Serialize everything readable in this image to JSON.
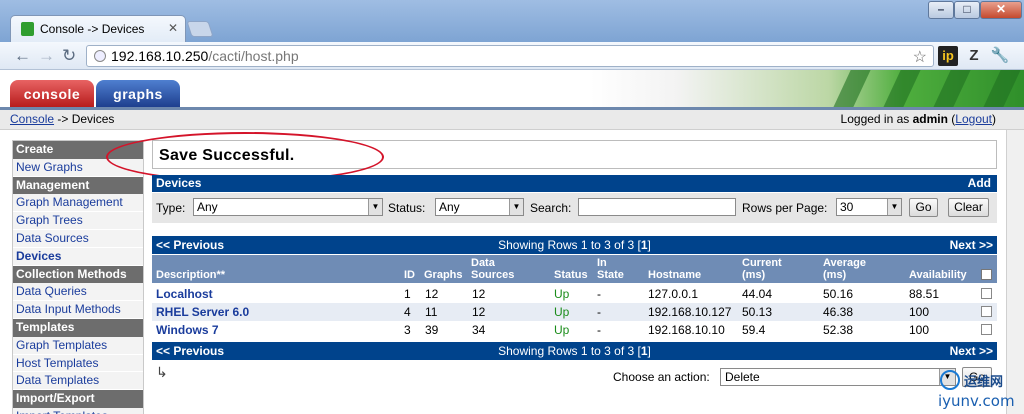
{
  "browser": {
    "tab_title": "Console -> Devices",
    "tab_close": "✕",
    "url_host": "192.168.10.250",
    "url_path": "/cacti/host.php",
    "ext_ip": "ip",
    "ext_z": "Z",
    "win_min": "–",
    "win_max": "□",
    "win_close": "✕"
  },
  "header": {
    "tab_console": "console",
    "tab_graphs": "graphs"
  },
  "breadcrumb": {
    "link": "Console",
    "rest": " -> Devices"
  },
  "login": {
    "prefix": "Logged in as ",
    "user": "admin",
    "open": " (",
    "logout": "Logout",
    "close": ")"
  },
  "sidebar": {
    "rows": [
      {
        "type": "head",
        "label": "Create"
      },
      {
        "type": "item",
        "label": "New Graphs"
      },
      {
        "type": "head",
        "label": "Management"
      },
      {
        "type": "item",
        "label": "Graph Management"
      },
      {
        "type": "item",
        "label": "Graph Trees"
      },
      {
        "type": "item",
        "label": "Data Sources"
      },
      {
        "type": "item",
        "label": "Devices",
        "active": true
      },
      {
        "type": "head",
        "label": "Collection Methods"
      },
      {
        "type": "item",
        "label": "Data Queries"
      },
      {
        "type": "item",
        "label": "Data Input Methods"
      },
      {
        "type": "head",
        "label": "Templates"
      },
      {
        "type": "item",
        "label": "Graph Templates"
      },
      {
        "type": "item",
        "label": "Host Templates"
      },
      {
        "type": "item",
        "label": "Data Templates"
      },
      {
        "type": "head",
        "label": "Import/Export"
      },
      {
        "type": "item",
        "label": "Import Templates"
      }
    ]
  },
  "message": "Save Successful.",
  "devices_panel": {
    "title": "Devices",
    "add": "Add",
    "type_label": "Type:",
    "type_value": "Any",
    "status_label": "Status:",
    "status_value": "Any",
    "search_label": "Search:",
    "search_value": "",
    "rows_label": "Rows per Page:",
    "rows_value": "30",
    "go": "Go",
    "clear": "Clear"
  },
  "pager": {
    "prev": "<< Previous",
    "text": "Showing Rows 1 to 3 of 3 [",
    "page": "1",
    "text_end": "]",
    "next": "Next >>"
  },
  "columns": {
    "description": "Description**",
    "id": "ID",
    "graphs": "Graphs",
    "data_sources_1": "Data",
    "data_sources_2": "Sources",
    "status": "Status",
    "in_state_1": "In",
    "in_state_2": "State",
    "hostname": "Hostname",
    "current_1": "Current",
    "current_2": "(ms)",
    "average_1": "Average",
    "average_2": "(ms)",
    "availability": "Availability"
  },
  "rows": [
    {
      "description": "Localhost",
      "id": "1",
      "graphs": "12",
      "data_sources": "12",
      "status": "Up",
      "in_state": "-",
      "hostname": "127.0.0.1",
      "current": "44.04",
      "average": "50.16",
      "availability": "88.51"
    },
    {
      "description": "RHEL Server 6.0",
      "id": "4",
      "graphs": "11",
      "data_sources": "12",
      "status": "Up",
      "in_state": "-",
      "hostname": "192.168.10.127",
      "current": "50.13",
      "average": "46.38",
      "availability": "100"
    },
    {
      "description": "Windows 7",
      "id": "3",
      "graphs": "39",
      "data_sources": "34",
      "status": "Up",
      "in_state": "-",
      "hostname": "192.168.10.10",
      "current": "59.4",
      "average": "52.38",
      "availability": "100"
    }
  ],
  "action": {
    "arrow": "↳",
    "label": "Choose an action:",
    "value": "Delete",
    "go": "Go"
  },
  "watermark": {
    "cn": "运维网",
    "url": "iyunv.com"
  }
}
